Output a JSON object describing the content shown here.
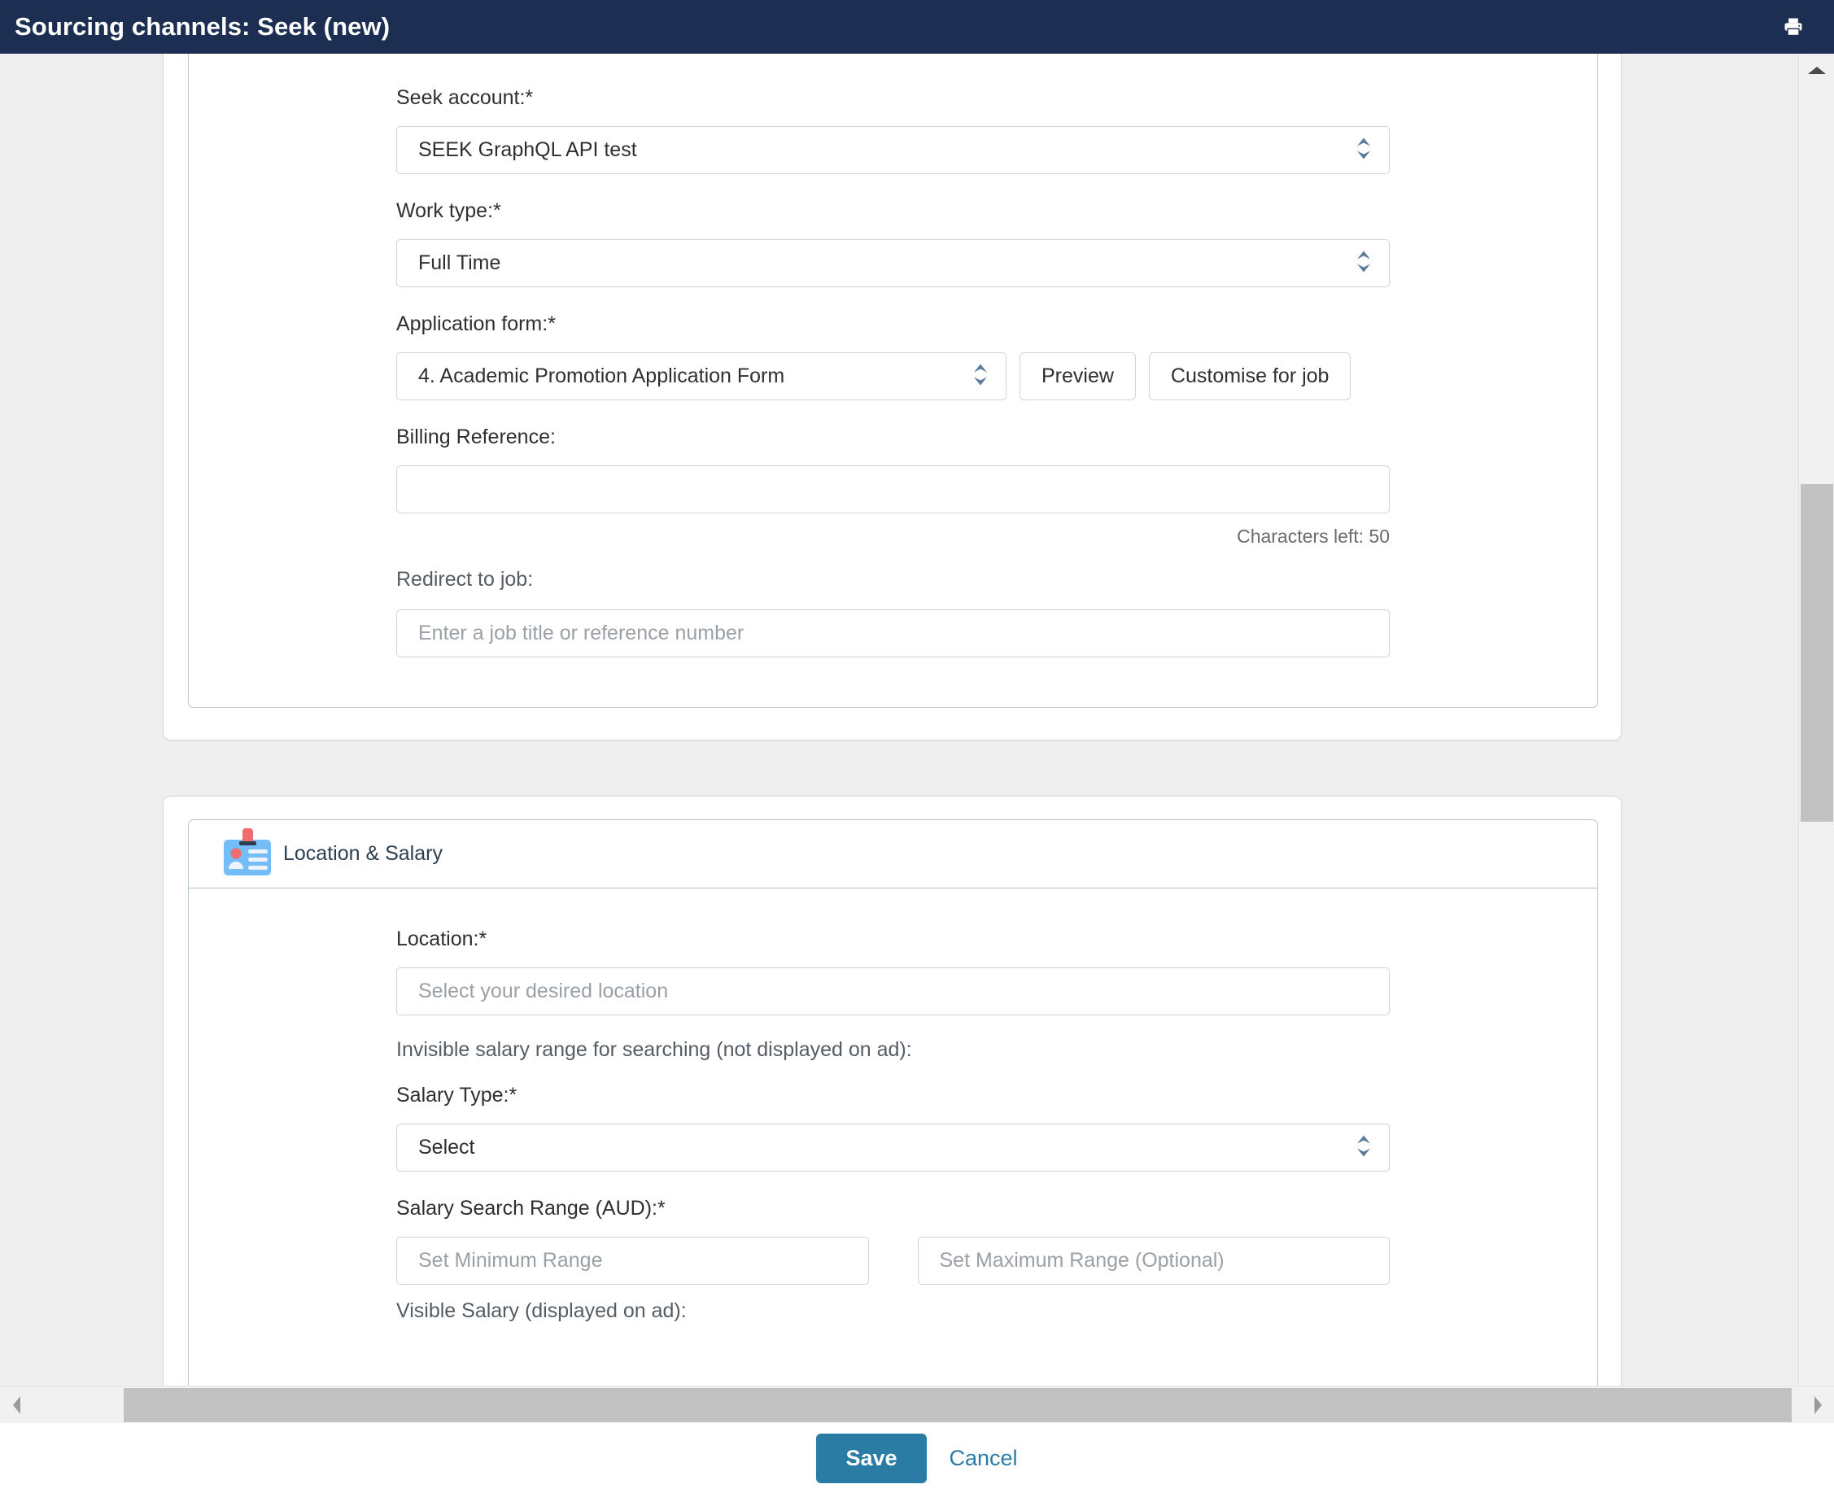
{
  "header": {
    "title": "Sourcing channels: Seek (new)",
    "print_icon": "printer-icon"
  },
  "sections": [
    {
      "id": "seek-details",
      "fields": {
        "seek_account": {
          "label": "Seek account:*",
          "value": "SEEK GraphQL API test"
        },
        "work_type": {
          "label": "Work type:*",
          "value": "Full Time"
        },
        "application_form": {
          "label": "Application form:*",
          "value": "4. Academic Promotion Application Form",
          "preview_label": "Preview",
          "customise_label": "Customise for job"
        },
        "billing_reference": {
          "label": "Billing Reference:",
          "value": "",
          "placeholder": "",
          "hint": "Characters left: 50"
        },
        "redirect_to_job": {
          "label": "Redirect to job:",
          "value": "",
          "placeholder": "Enter a job title or reference number"
        }
      }
    },
    {
      "id": "location-salary",
      "title": "Location & Salary",
      "icon": "id-badge-icon",
      "fields": {
        "location": {
          "label": "Location:*",
          "value": "",
          "placeholder": "Select your desired location"
        },
        "invisible_salary_note": "Invisible salary range for searching (not displayed on ad):",
        "salary_type": {
          "label": "Salary Type:*",
          "value": "Select"
        },
        "salary_search_range": {
          "label": "Salary Search Range (AUD):*",
          "min_placeholder": "Set Minimum Range",
          "max_placeholder": "Set Maximum Range (Optional)",
          "min_value": "",
          "max_value": ""
        },
        "visible_salary_note": "Visible Salary (displayed on ad):"
      }
    }
  ],
  "footer": {
    "save_label": "Save",
    "cancel_label": "Cancel"
  },
  "colors": {
    "header_bg": "#1c2f52",
    "accent": "#2a7ca5",
    "panel_border": "#b9c6d4",
    "icon_blue": "#74bdf7",
    "icon_red": "#ef6d6d"
  }
}
